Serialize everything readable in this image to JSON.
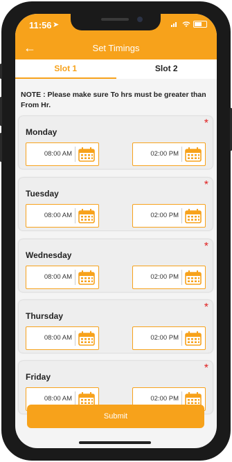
{
  "status": {
    "time": "11:56",
    "location_glyph": "➤"
  },
  "header": {
    "back_glyph": "←",
    "title": "Set Timings"
  },
  "tabs": [
    {
      "label": "Slot 1"
    },
    {
      "label": "Slot 2"
    }
  ],
  "note": "NOTE : Please make sure To hrs must be greater than From Hr.",
  "days": [
    {
      "name": "Monday",
      "from": "08:00 AM",
      "to": "02:00 PM"
    },
    {
      "name": "Tuesday",
      "from": "08:00 AM",
      "to": "02:00 PM"
    },
    {
      "name": "Wednesday",
      "from": "08:00 AM",
      "to": "02:00 PM"
    },
    {
      "name": "Thursday",
      "from": "08:00 AM",
      "to": "02:00 PM"
    },
    {
      "name": "Friday",
      "from": "08:00 AM",
      "to": "02:00 PM"
    }
  ],
  "required_mark": "*",
  "submit_label": "Submit",
  "colors": {
    "accent": "#f7a21b",
    "required": "#e02020"
  },
  "icons": {
    "back": "arrow-left-icon",
    "calendar": "calendar-icon"
  }
}
